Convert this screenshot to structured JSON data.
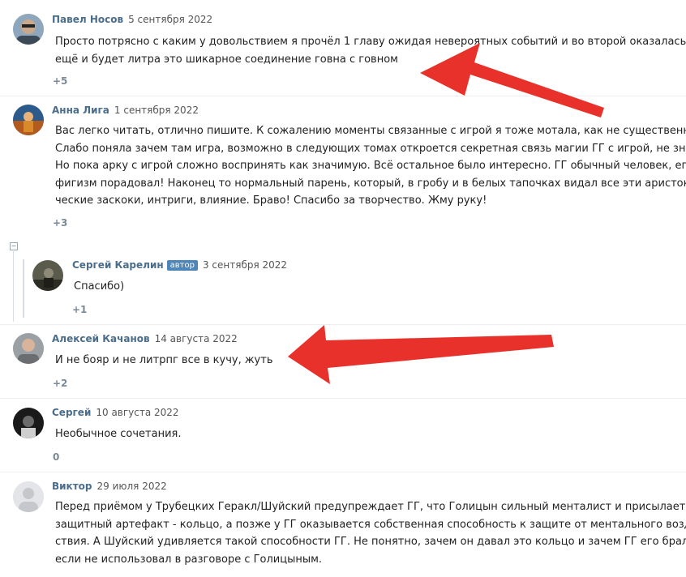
{
  "comments": [
    {
      "author": "Павел Носов",
      "date": "5 сентября 2022",
      "lines": [
        "Просто потрясно с каким у довольствием я прочёл 1 главу ожидая невероятных событий и во второй оказалась что",
        "ещё и будет литра это шикарное соединение говна с говном"
      ],
      "votes": "+5",
      "avatar_icon": "user-photo-avatar"
    },
    {
      "author": "Анна Лига",
      "date": "1 сентября 2022",
      "lines": [
        "Вас легко читать, отлично пишите. К сожалению моменты связанные с игрой я тоже мотала, как не существенные.",
        "Слабо поняла зачем там игра, возможно в следующих томах откроется секретная связь магии ГГ с игрой, не знаю.",
        "Но пока арку с игрой сложно воспринять как значимую. Всё остальное было интересно. ГГ обычный человек, его по-",
        "фигизм порадовал! Наконец то нормальный парень, который, в гробу и в белых тапочках видал все эти аристократи-",
        "ческие заскоки, интриги, влияние. Браво! Спасибо за творчество. Жму руку!"
      ],
      "votes": "+3",
      "avatar_icon": "user-photo-avatar"
    },
    {
      "author": "Сергей Карелин",
      "badge": "автор",
      "date": "3 сентября 2022",
      "lines": [
        "Спасибо)"
      ],
      "votes": "+1",
      "avatar_icon": "user-photo-avatar"
    },
    {
      "author": "Алексей Качанов",
      "date": "14 августа 2022",
      "lines": [
        "И не бояр и не литрпг все в кучу, жуть"
      ],
      "votes": "+2",
      "avatar_icon": "user-photo-avatar"
    },
    {
      "author": "Сергей",
      "date": "10 августа 2022",
      "lines": [
        "Необычное сочетания."
      ],
      "votes": "0",
      "avatar_icon": "user-photo-avatar"
    },
    {
      "author": "Виктор",
      "date": "29 июля 2022",
      "lines": [
        "Перед приёмом у Трубецких Геракл/Шуйский предупреждает ГГ, что Голицын сильный менталист и присылает ему",
        "защитный артефакт - кольцо, а позже у ГГ оказывается собственная способность к защите от ментального воздей-",
        "ствия.  А Шуйский удивляется такой способности ГГ.  Не понятно, зачем он давал это кольцо и зачем ГГ его брал,",
        "если не использовал в разговоре с Голицыным."
      ],
      "votes": "",
      "avatar_icon": "default-avatar"
    }
  ],
  "thread_collapse_symbol": "−",
  "annotation_color": "#e8312b"
}
